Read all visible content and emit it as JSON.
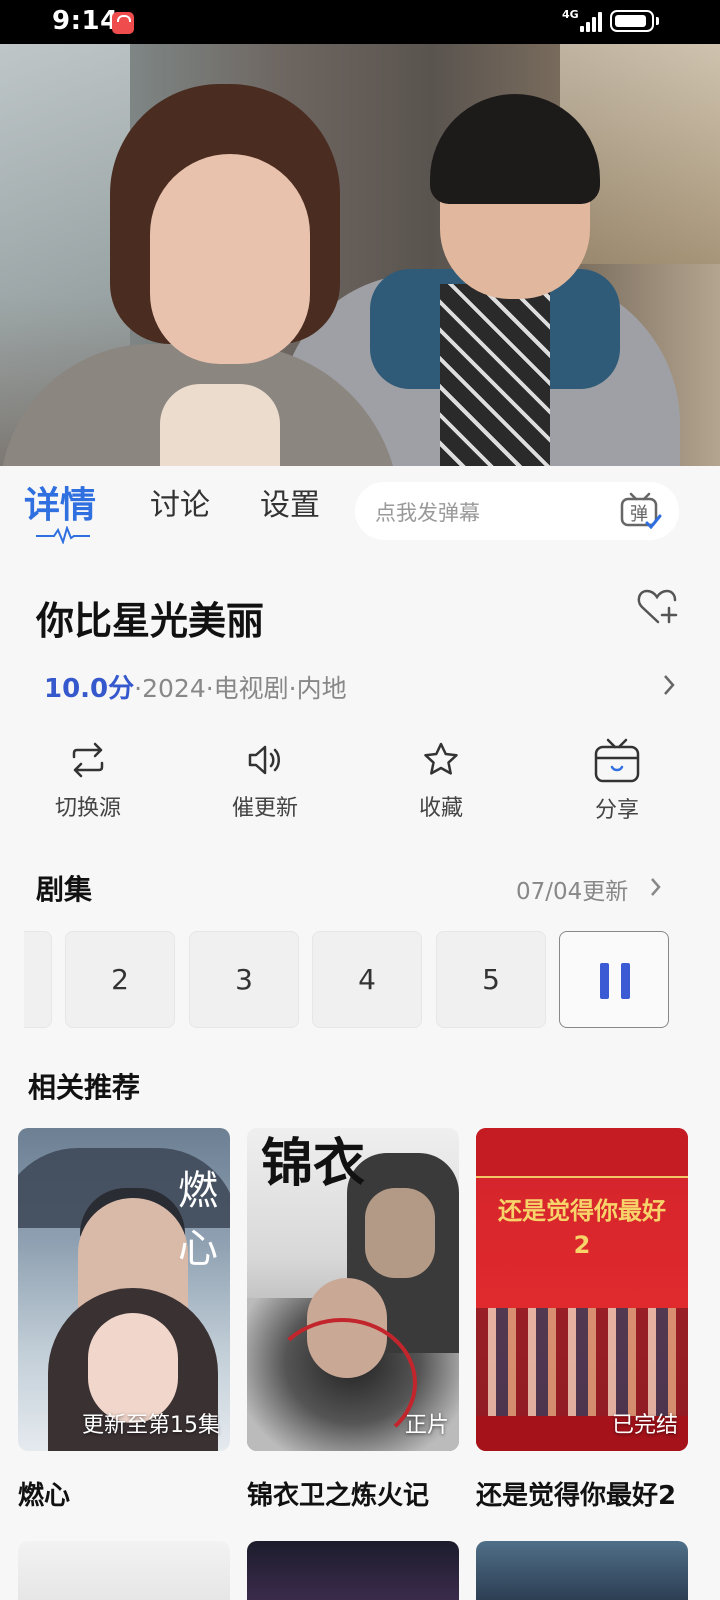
{
  "status_bar": {
    "time": "9:14",
    "network": "4G"
  },
  "tabs": [
    {
      "label": "详情",
      "active": true
    },
    {
      "label": "讨论",
      "active": false
    },
    {
      "label": "设置",
      "active": false
    }
  ],
  "danmaku": {
    "placeholder": "点我发弹幕",
    "icon_text": "弹"
  },
  "show": {
    "title": "你比星光美丽",
    "score": "10.0分",
    "meta": "·2024·电视剧·内地"
  },
  "actions": [
    {
      "label": "切换源",
      "icon": "switch-source-icon"
    },
    {
      "label": "催更新",
      "icon": "speaker-icon"
    },
    {
      "label": "收藏",
      "icon": "star-icon"
    },
    {
      "label": "分享",
      "icon": "tv-share-icon"
    }
  ],
  "episodes": {
    "section_title": "剧集",
    "update_text": "07/04更新",
    "items": [
      "2",
      "3",
      "4",
      "5"
    ],
    "current_icon": "pause-icon"
  },
  "recommendations": {
    "section_title": "相关推荐",
    "items": [
      {
        "title": "燃心",
        "badge": "更新至第15集",
        "poster_text": "燃心"
      },
      {
        "title": "锦衣卫之炼火记",
        "badge": "正片",
        "poster_text": "锦衣"
      },
      {
        "title": "还是觉得你最好2",
        "badge": "已完结",
        "poster_text": "还是觉得你最好2"
      }
    ]
  },
  "colors": {
    "accent": "#2f6fe0",
    "score": "#3558cc",
    "pause": "#3a5bd3"
  }
}
